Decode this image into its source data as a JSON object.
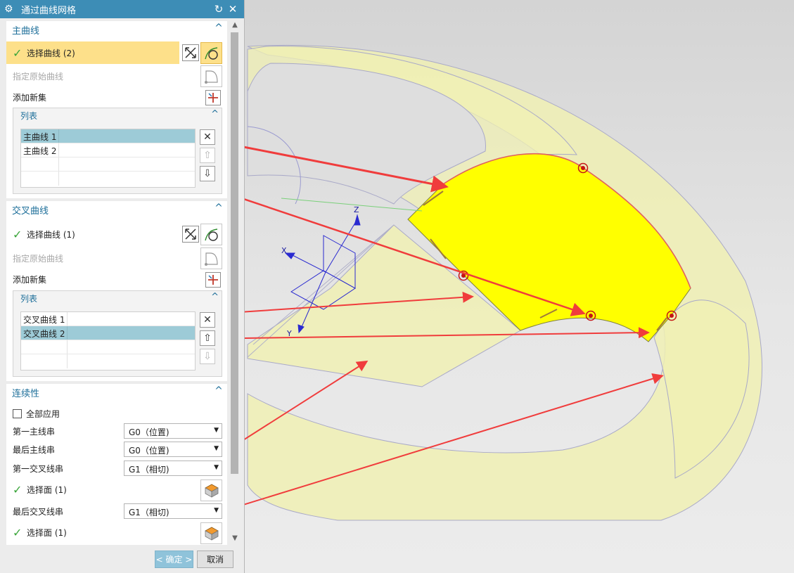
{
  "dialog": {
    "title": "通过曲线网格",
    "primary": {
      "title": "主曲线",
      "select_label": "选择曲线 (2)",
      "specify_label": "指定原始曲线",
      "add_label": "添加新集",
      "list_title": "列表",
      "items": [
        "主曲线 1",
        "主曲线 2"
      ]
    },
    "cross": {
      "title": "交叉曲线",
      "select_label": "选择曲线 (1)",
      "specify_label": "指定原始曲线",
      "add_label": "添加新集",
      "list_title": "列表",
      "items": [
        "交叉曲线 1",
        "交叉曲线 2"
      ]
    },
    "continuity": {
      "title": "连续性",
      "apply_all": "全部应用",
      "first_primary": {
        "label": "第一主线串",
        "value": "G0（位置)"
      },
      "last_primary": {
        "label": "最后主线串",
        "value": "G0（位置)"
      },
      "first_cross": {
        "label": "第一交叉线串",
        "value": "G1（相切)"
      },
      "face1": "选择面 (1)",
      "last_cross": {
        "label": "最后交叉线串",
        "value": "G1（相切)"
      },
      "face2": "选择面 (1)"
    },
    "ok_label": "< 确定 >",
    "cancel_label": "取消"
  },
  "viewport": {
    "axes": {
      "x": "X",
      "y": "Y",
      "z": "Z"
    },
    "colors": {
      "surface_fill": "#ffff00",
      "band_fill": "#f0f0b4",
      "arrow": "#f03c3c",
      "point_marker": "#c41414",
      "primary_edge": "#e06060"
    }
  }
}
